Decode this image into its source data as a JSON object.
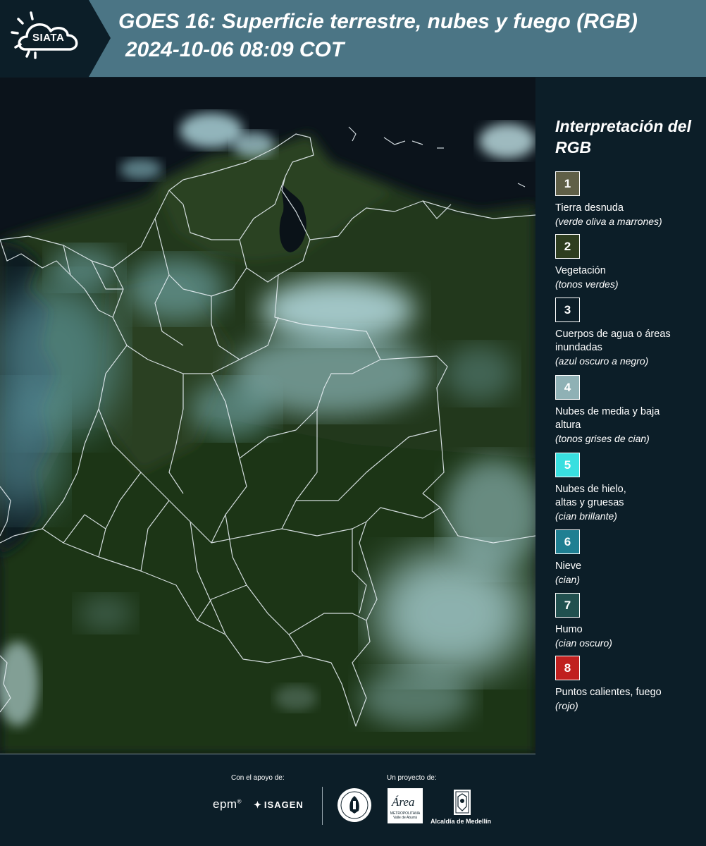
{
  "header": {
    "logo_text": "SIATA",
    "title_line1": "GOES 16: Superficie terrestre, nubes y fuego (RGB)",
    "title_line2": "2024-10-06 08:09 COT",
    "background_color": "#4b7585",
    "logo_background_color": "#0c1e28"
  },
  "map": {
    "description_icon": "satellite-rgb-composite",
    "boundary_color": "#e6eef2"
  },
  "legend": {
    "title": "Interpretación del RGB",
    "items": [
      {
        "number": "1",
        "label": "Tierra desnuda",
        "note": "(verde oliva a marrones)",
        "color": "#5f5f47"
      },
      {
        "number": "2",
        "label": "Vegetación",
        "note": "(tonos verdes)",
        "color": "#2e3d1f"
      },
      {
        "number": "3",
        "label": "Cuerpos de agua o áreas inundadas",
        "note": "(azul oscuro a negro)",
        "color": "#0c1e28"
      },
      {
        "number": "4",
        "label": "Nubes de media y baja altura",
        "note": "(tonos grises de cian)",
        "color": "#8fb1b5"
      },
      {
        "number": "5",
        "label": "Nubes de hielo, altas y gruesas",
        "note": "(cian brillante)",
        "color": "#39dfe0"
      },
      {
        "number": "6",
        "label": "Nieve",
        "note": "(cian)",
        "color": "#1f7f92"
      },
      {
        "number": "7",
        "label": "Humo",
        "note": "(cian oscuro)",
        "color": "#21504f"
      },
      {
        "number": "8",
        "label": "Puntos calientes, fuego",
        "note": "(rojo)",
        "color": "#c0201f"
      }
    ]
  },
  "footer": {
    "support_label": "Con el apoyo de:",
    "project_label": "Un proyecto de:",
    "epm": "epm",
    "epm_mark": "®",
    "isagen": "ISAGEN",
    "area_word": "Área",
    "area_sub": "METROPOLITANA Valle de Aburrá",
    "medellin_label": "Alcaldía de Medellín"
  }
}
